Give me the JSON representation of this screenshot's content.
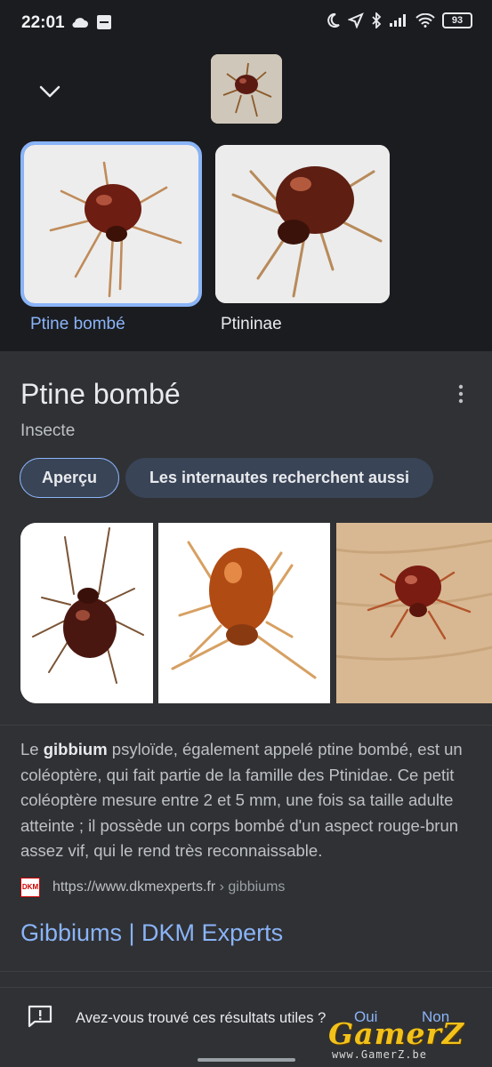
{
  "status_bar": {
    "time": "22:01",
    "battery": "93",
    "left_icons": [
      "cloud-icon",
      "ifttt-icon"
    ],
    "right_icons": [
      "moon-icon",
      "location-arrow-icon",
      "bluetooth-icon",
      "signal-icon",
      "wifi-icon",
      "battery-icon"
    ]
  },
  "lens": {
    "matches": [
      {
        "label": "Ptine bombé",
        "selected": true
      },
      {
        "label": "Ptininae",
        "selected": false
      }
    ]
  },
  "knowledge_panel": {
    "title": "Ptine bombé",
    "subtitle": "Insecte",
    "chips": [
      "Aperçu",
      "Les internautes recherchent aussi"
    ],
    "description_prefix": "Le ",
    "description_bold": "gibbium",
    "description_rest": " psyloïde, également appelé ptine bombé, est un coléoptère, qui fait partie de la famille des Ptinidae. Ce petit coléoptère mesure entre 2 et 5 mm, une fois sa taille adulte atteinte ; il possède un corps bombé d'un aspect rouge-brun assez vif, qui le rend très reconnaissable.",
    "source_logo": "DKM",
    "source_url": "https://www.dkmexperts.fr",
    "source_path": " › gibbiums",
    "result_link": "Gibbiums | DKM Experts"
  },
  "feedback": {
    "question": "Avez-vous trouvé ces résultats utiles ?",
    "yes": "Oui",
    "no": "Non"
  },
  "watermark": {
    "text": "GamerZ",
    "url": "www.GamerZ.be"
  }
}
